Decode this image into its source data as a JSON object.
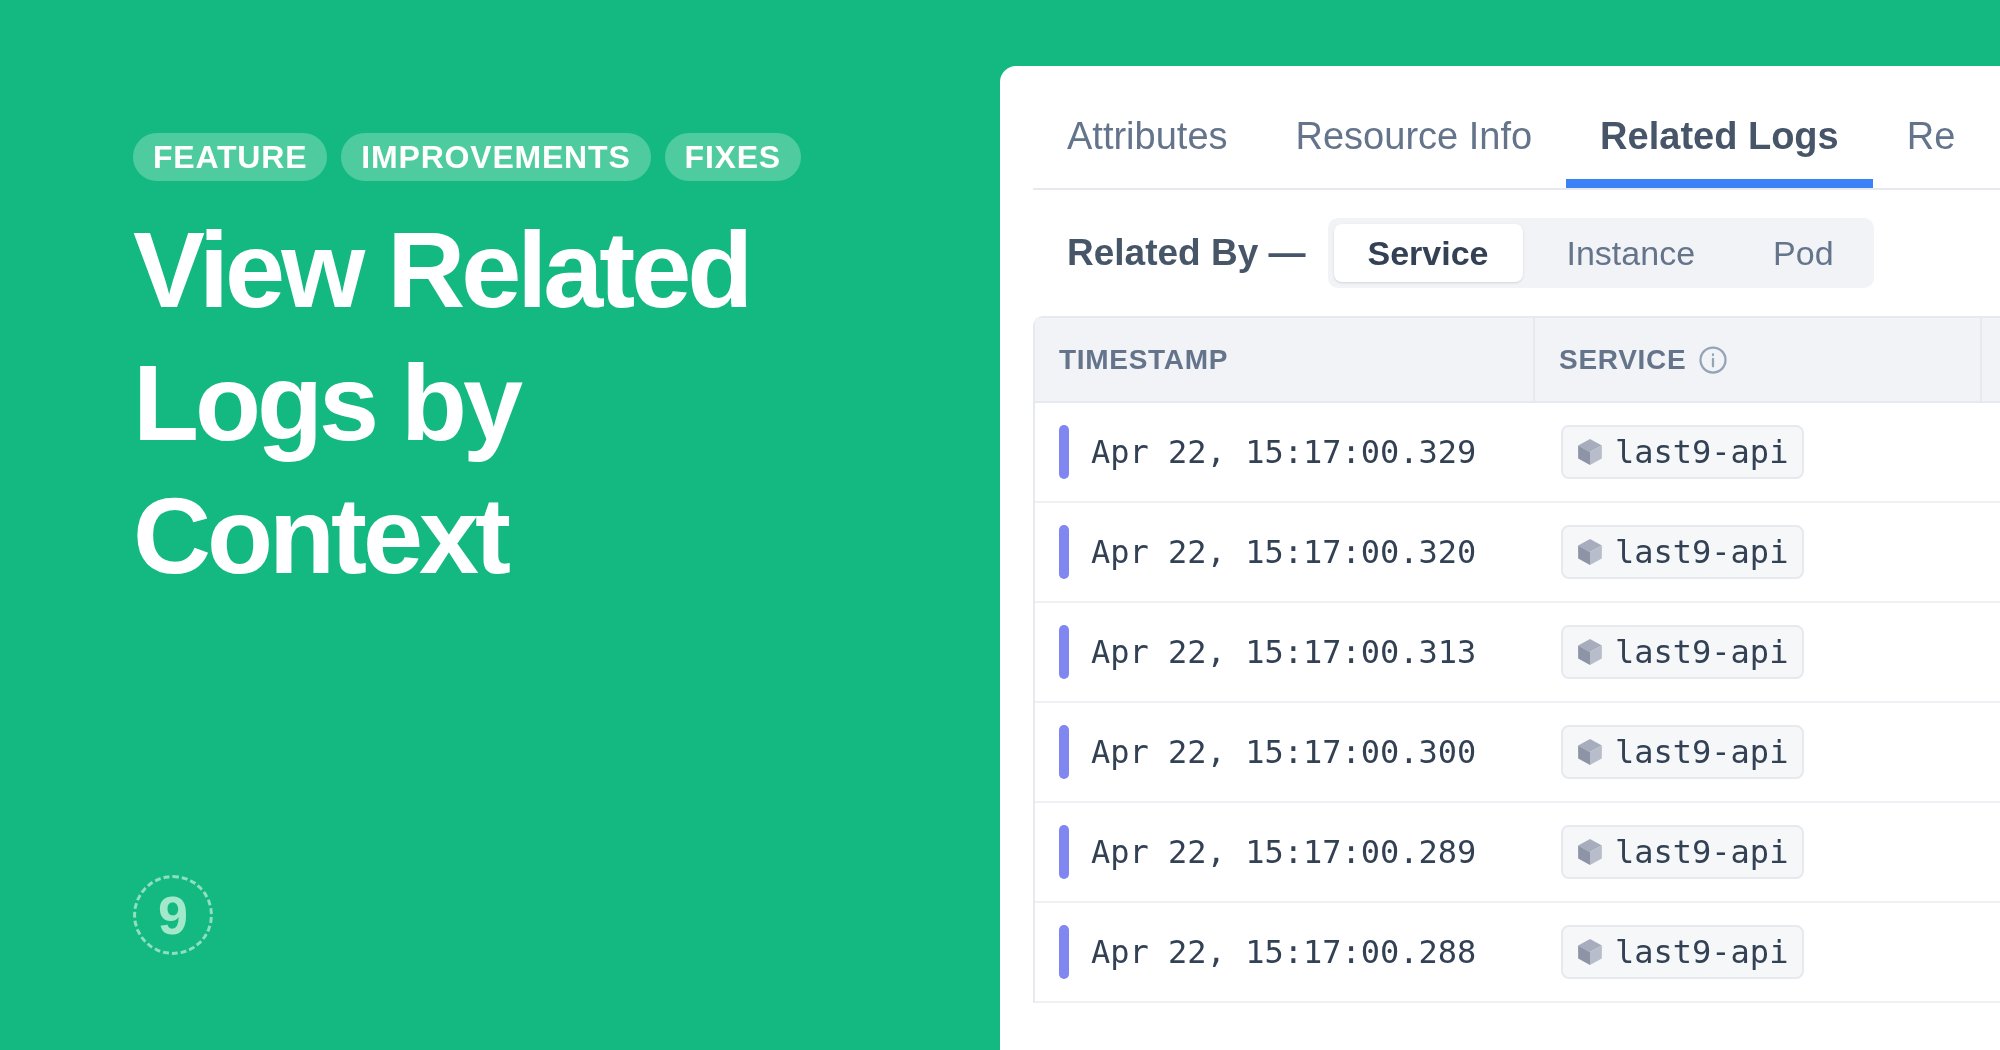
{
  "tags": [
    "FEATURE",
    "IMPROVEMENTS",
    "FIXES"
  ],
  "headline": [
    "View Related",
    "Logs by",
    "Context"
  ],
  "logo": {
    "text": "9"
  },
  "panel": {
    "tabs": [
      {
        "label": "Attributes",
        "selected": false
      },
      {
        "label": "Resource Info",
        "selected": false
      },
      {
        "label": "Related Logs",
        "selected": true
      },
      {
        "label": "Re",
        "selected": false
      }
    ],
    "related_by": {
      "label": "Related By —",
      "options": [
        {
          "label": "Service",
          "selected": true
        },
        {
          "label": "Instance",
          "selected": false
        },
        {
          "label": "Pod",
          "selected": false
        }
      ]
    },
    "table": {
      "columns": [
        {
          "label": "TIMESTAMP",
          "kind": "plain"
        },
        {
          "label": "SERVICE",
          "kind": "info"
        }
      ],
      "rows": [
        {
          "timestamp": "Apr 22, 15:17:00.329",
          "service": "last9-api",
          "color": "#8187f0"
        },
        {
          "timestamp": "Apr 22, 15:17:00.320",
          "service": "last9-api",
          "color": "#8187f0"
        },
        {
          "timestamp": "Apr 22, 15:17:00.313",
          "service": "last9-api",
          "color": "#8187f0"
        },
        {
          "timestamp": "Apr 22, 15:17:00.300",
          "service": "last9-api",
          "color": "#8187f0"
        },
        {
          "timestamp": "Apr 22, 15:17:00.289",
          "service": "last9-api",
          "color": "#8187f0"
        },
        {
          "timestamp": "Apr 22, 15:17:00.288",
          "service": "last9-api",
          "color": "#8187f0"
        }
      ]
    }
  }
}
